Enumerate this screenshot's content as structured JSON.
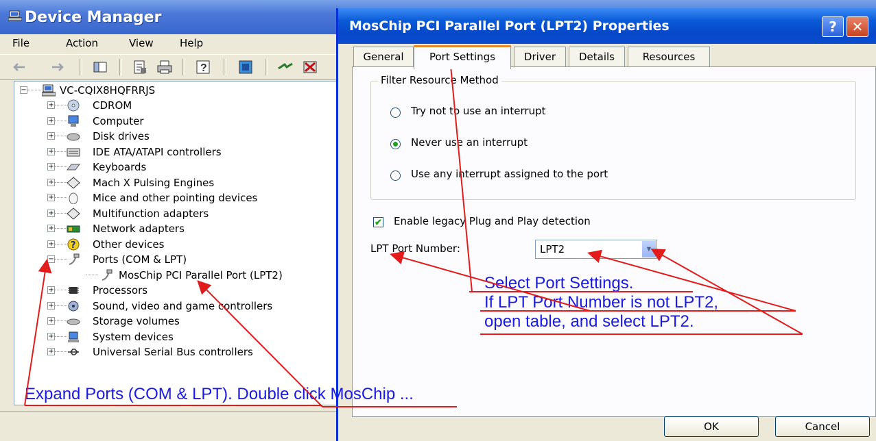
{
  "device_manager": {
    "title": "Device Manager",
    "menu": [
      "File",
      "Action",
      "View",
      "Help"
    ],
    "toolbar_icons": [
      "back-icon",
      "forward-icon",
      "console-tree-icon",
      "properties-icon",
      "print-icon",
      "help-icon",
      "scan-hardware-icon",
      "update-driver-icon",
      "uninstall-icon"
    ],
    "tree": {
      "root": "VC-CQIX8HQFRRJS",
      "items": [
        {
          "label": "CDROM",
          "icon": "cdrom-icon"
        },
        {
          "label": "Computer",
          "icon": "computer-icon"
        },
        {
          "label": "Disk drives",
          "icon": "disk-drive-icon"
        },
        {
          "label": "IDE ATA/ATAPI controllers",
          "icon": "ide-controller-icon"
        },
        {
          "label": "Keyboards",
          "icon": "keyboard-icon"
        },
        {
          "label": "Mach  X Pulsing Engines",
          "icon": "diamond-icon"
        },
        {
          "label": "Mice and other pointing devices",
          "icon": "mouse-icon"
        },
        {
          "label": "Multifunction adapters",
          "icon": "diamond-icon"
        },
        {
          "label": "Network adapters",
          "icon": "network-adapter-icon"
        },
        {
          "label": "Other devices",
          "icon": "question-icon"
        },
        {
          "label": "Ports (COM & LPT)",
          "icon": "port-icon"
        },
        {
          "label": "MosChip PCI Parallel Port (LPT2)",
          "icon": "port-icon"
        },
        {
          "label": "Processors",
          "icon": "processor-icon"
        },
        {
          "label": "Sound, video and game controllers",
          "icon": "sound-icon"
        },
        {
          "label": "Storage volumes",
          "icon": "storage-icon"
        },
        {
          "label": "System devices",
          "icon": "system-devices-icon"
        },
        {
          "label": "Universal Serial Bus controllers",
          "icon": "usb-icon"
        }
      ]
    }
  },
  "dialog": {
    "title": "MosChip PCI Parallel Port (LPT2) Properties",
    "help_glyph": "?",
    "close_glyph": "✕",
    "tabs": [
      "General",
      "Port Settings",
      "Driver",
      "Details",
      "Resources"
    ],
    "active_tab": "Port Settings",
    "group_title": "Filter Resource Method",
    "radio_options": [
      "Try not to use an interrupt",
      "Never use an interrupt",
      "Use any interrupt assigned to the port"
    ],
    "selected_radio": "Never use an interrupt",
    "checkbox_label": "Enable legacy Plug and Play detection",
    "checkbox_checked": true,
    "checkbox_mark": "✔",
    "lpt_label": "LPT Port Number:",
    "lpt_value": "LPT2",
    "dropdown_arrow": "▼",
    "ok_label": "OK",
    "cancel_label": "Cancel"
  },
  "annotations": {
    "note_right": [
      "Select Port Settings.",
      "If LPT Port Number is not LPT2,",
      "open table, and select LPT2."
    ],
    "note_bottom": "Expand Ports (COM & LPT). Double click MosChip ...",
    "arrow_color": "#e21b1b",
    "text_color": "#1a1ae6"
  },
  "colors": {
    "window_bg": "#ece9d8",
    "title_blue": "#0a5ad8",
    "tab_highlight": "#e68b2c"
  }
}
